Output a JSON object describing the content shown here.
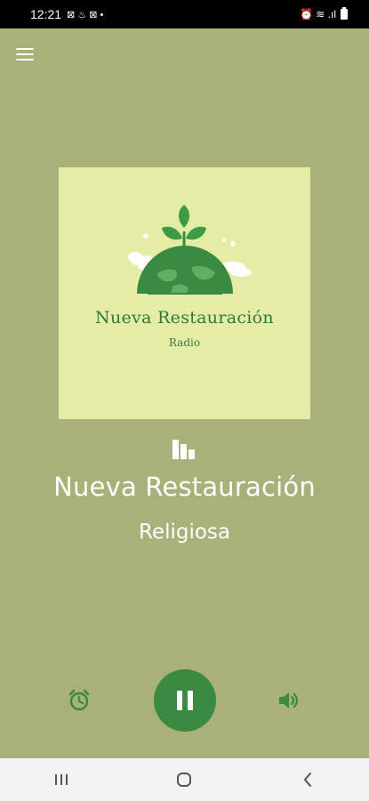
{
  "status_bar": {
    "time": "12:21",
    "notif_icons": "⊠ ♨ ⊠ •",
    "right_icons": "⏰ ≋ .ıl"
  },
  "header": {
    "menu_icon": "hamburger-menu-icon"
  },
  "artwork": {
    "logo_title": "Nueva Restauración",
    "logo_subtitle": "Radio",
    "colors": {
      "background": "#e5eca6",
      "leaf": "#3f9a45",
      "globe": "#3a8a41"
    }
  },
  "station": {
    "name": "Nueva Restauración",
    "genre": "Religiosa"
  },
  "controls": {
    "alarm_icon": "alarm-clock-icon",
    "play_state": "playing",
    "pause_icon": "pause-icon",
    "volume_icon": "volume-icon"
  },
  "theme": {
    "background": "#a9b07a",
    "accent": "#3a8a41",
    "text": "#ffffff"
  },
  "nav_bar": {
    "items": [
      "recent-apps-icon",
      "home-icon",
      "back-icon"
    ]
  }
}
